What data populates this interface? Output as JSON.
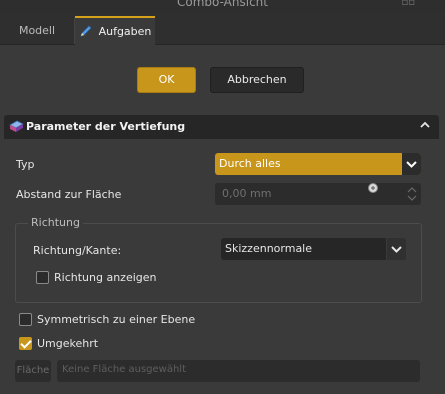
{
  "window": {
    "title": "Combo-Ansicht"
  },
  "tabs": [
    {
      "label": "Modell",
      "active": false
    },
    {
      "label": "Aufgaben",
      "active": true
    }
  ],
  "dialog_buttons": {
    "ok": "OK",
    "cancel": "Abbrechen"
  },
  "panel": {
    "title": "Parameter der Vertiefung",
    "type_label": "Typ",
    "type_value": "Durch alles",
    "distance_label": "Abstand zur Fläche",
    "distance_value": "0,00 mm",
    "direction_group": {
      "title": "Richtung",
      "edge_label": "Richtung/Kante:",
      "edge_value": "Skizzennormale",
      "show_direction": {
        "label": "Richtung anzeigen",
        "checked": false
      }
    },
    "symmetric": {
      "label": "Symmetrisch zu einer Ebene",
      "checked": false
    },
    "reversed": {
      "label": "Umgekehrt",
      "checked": true
    },
    "face_button": "Fläche",
    "face_placeholder": "Keine Fläche ausgewählt"
  },
  "colors": {
    "accent": "#c8961a",
    "background": "#3a3a3a",
    "header": "#262626"
  }
}
